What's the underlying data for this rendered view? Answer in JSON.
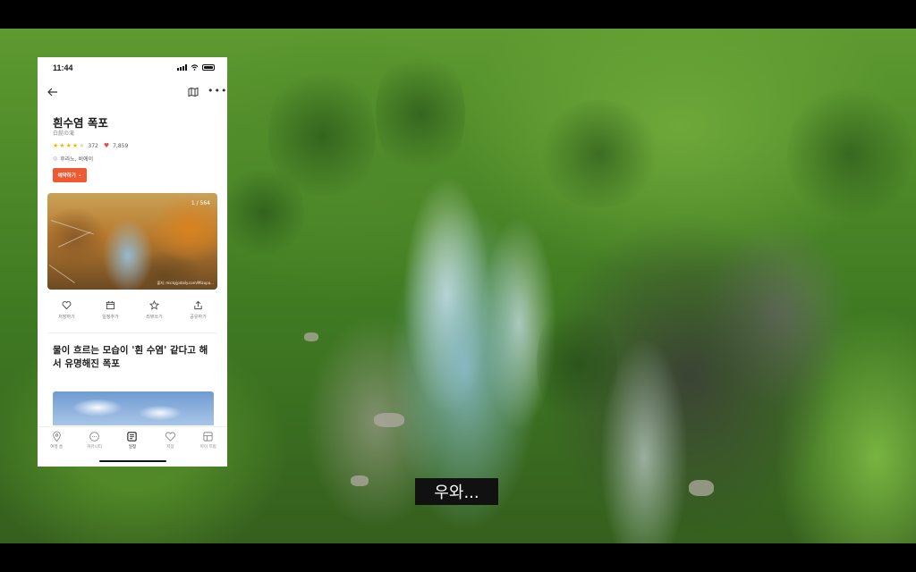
{
  "status_bar": {
    "time": "11:44"
  },
  "place": {
    "name": "흰수염 폭포",
    "name_local": "白髭の滝",
    "rating_count": "372",
    "likes_count": "7,859",
    "location": "후라노, 비에이",
    "stars_filled": 4,
    "stars_total": 5
  },
  "reserve_button": {
    "label": "예약하기"
  },
  "photo": {
    "counter": "1 / 564",
    "credit": "출처: mickyjpdaily.com/Mizupa..."
  },
  "actions": [
    {
      "label": "저장하기",
      "icon": "heart-outline-icon"
    },
    {
      "label": "일정추가",
      "icon": "calendar-icon"
    },
    {
      "label": "리뷰쓰기",
      "icon": "star-outline-icon"
    },
    {
      "label": "공유하기",
      "icon": "share-icon"
    }
  ],
  "headline": "물이 흐르는 모습이 '흰 수염' 같다고 해서 유명해진 폭포",
  "tabs": [
    {
      "label": "여행 홈",
      "icon": "map-pin-icon",
      "active": false
    },
    {
      "label": "커뮤니티",
      "icon": "chat-icon",
      "active": false
    },
    {
      "label": "일정",
      "icon": "schedule-icon",
      "active": true
    },
    {
      "label": "저장",
      "icon": "heart-icon",
      "active": false
    },
    {
      "label": "마이 트립",
      "icon": "trip-icon",
      "active": false
    }
  ],
  "video_caption": "우와...",
  "colors": {
    "accent": "#ef5a32",
    "star": "#f5b800",
    "heart": "#e34b4b"
  }
}
